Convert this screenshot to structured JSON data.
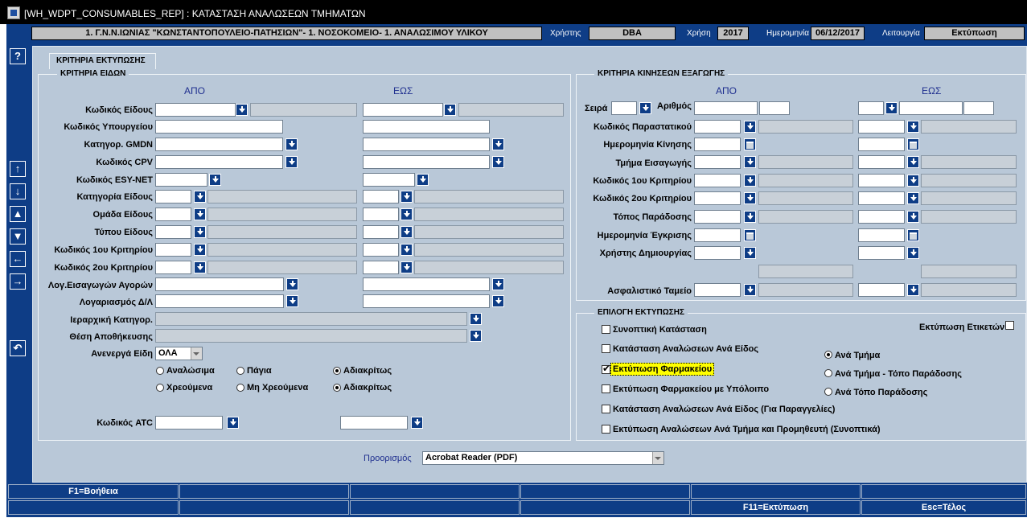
{
  "window": {
    "title": "[WH_WDPT_CONSUMABLES_REP]  :  ΚΑΤΑΣΤΑΣΗ ΑΝΑΛΩΣΕΩΝ ΤΜΗΜΑΤΩΝ"
  },
  "header": {
    "organization": "1. Γ.Ν.Ν.ΙΩΝΙΑΣ \"ΚΩΝΣΤΑΝΤΟΠΟΥΛΕΙΟ-ΠΑΤΗΣΙΩΝ\"- 1. ΝΟΣΟΚΟΜΕΙΟ- 1. ΑΝΑΛΩΣΙΜΟΥ ΥΛΙΚΟΥ",
    "user_label": "Χρήστης",
    "user_value": "DBA",
    "year_label": "Χρήση",
    "year_value": "2017",
    "date_label": "Ημερομηνία",
    "date_value": "06/12/2017",
    "mode_label": "Λειτουργία",
    "mode_value": "Εκτύπωση"
  },
  "toolbar": {
    "help": "?"
  },
  "tab": {
    "label": "ΚΡΙΤΗΡΙΑ ΕΚΤΥΠΩΣΗΣ"
  },
  "items_group": {
    "title": "ΚΡΙΤΗΡΙΑ ΕΙΔΩΝ",
    "col_from": "ΑΠΟ",
    "col_to": "ΕΩΣ",
    "labels": [
      "Κωδικός Είδους",
      "Κωδικός Υπουργείου",
      "Κατηγορ. GMDN",
      "Κωδικός CPV",
      "Κωδικός ESY-NET",
      "Κατηγορία Είδους",
      "Ομάδα Είδους",
      "Τύπου Είδους",
      "Κωδικός 1ου Κριτηρίου",
      "Κωδικός 2ου Κριτηρίου",
      "Λογ.Εισαγωγών Αγορών",
      "Λογαριασμός Δ/Λ",
      "Ιεραρχική Κατηγορ.",
      "Θέση Αποθήκευσης"
    ],
    "inactive_label": "Ανενεργά Είδη",
    "inactive_value": "ΟΛΑ",
    "radio_row1": [
      "Αναλώσιμα",
      "Πάγια",
      "Αδιακρίτως"
    ],
    "radio_row2": [
      "Χρεούμενα",
      "Μη Χρεούμενα",
      "Αδιακρίτως"
    ],
    "atc_label": "Κωδικός ATC"
  },
  "movement_group": {
    "title": "ΚΡΙΤΗΡΙΑ ΚΙΝΗΣΕΩΝ ΕΞΑΓΩΓΗΣ",
    "col_from": "ΑΠΟ",
    "col_to": "ΕΩΣ",
    "series_label": "Σειρά",
    "number_label": "Αριθμός",
    "labels": [
      "Κωδικός Παραστατικού",
      "Ημερομηνία Κίνησης",
      "Τμήμα Εισαγωγής",
      "Κωδικός 1ου Κριτηρίου",
      "Κωδικός 2ου Κριτηρίου",
      "Τόπος Παράδοσης",
      "Ημερομηνία Έγκρισης",
      "Χρήστης Δημιουργίας"
    ],
    "insurance_label": "Ασφαλιστικό Ταμείο"
  },
  "print_group": {
    "title": "ΕΠΙΛΟΓΗ ΕΚΤΥΠΩΣΗΣ",
    "labels_print": "Εκτύπωση Ετικετών",
    "checks": [
      "Συνοπτική Κατάσταση",
      "Κατάσταση Αναλώσεων Ανά Είδος",
      "Εκτύπωση Φαρμακείου",
      "Εκτύπωση Φαρμακείου με Υπόλοιπο",
      "Κατάσταση Αναλώσεων Ανά Είδος (Για Παραγγελίες)",
      "Εκτύπωση Αναλώσεων Ανά Τμήμα και Προμηθευτή (Συνοπτικά)"
    ],
    "checked_index": 2,
    "radios": [
      "Ανά Τμήμα",
      "Ανά Τμήμα - Τόπο Παράδοσης",
      "Ανά Τόπο Παράδοσης"
    ],
    "selected_radio": 0
  },
  "destination": {
    "label": "Προορισμός",
    "value": "Acrobat Reader (PDF)"
  },
  "fkeys": {
    "help": "F1=Βοήθεια",
    "print": "F11=Εκτύπωση",
    "exit": "Esc=Τέλος"
  }
}
